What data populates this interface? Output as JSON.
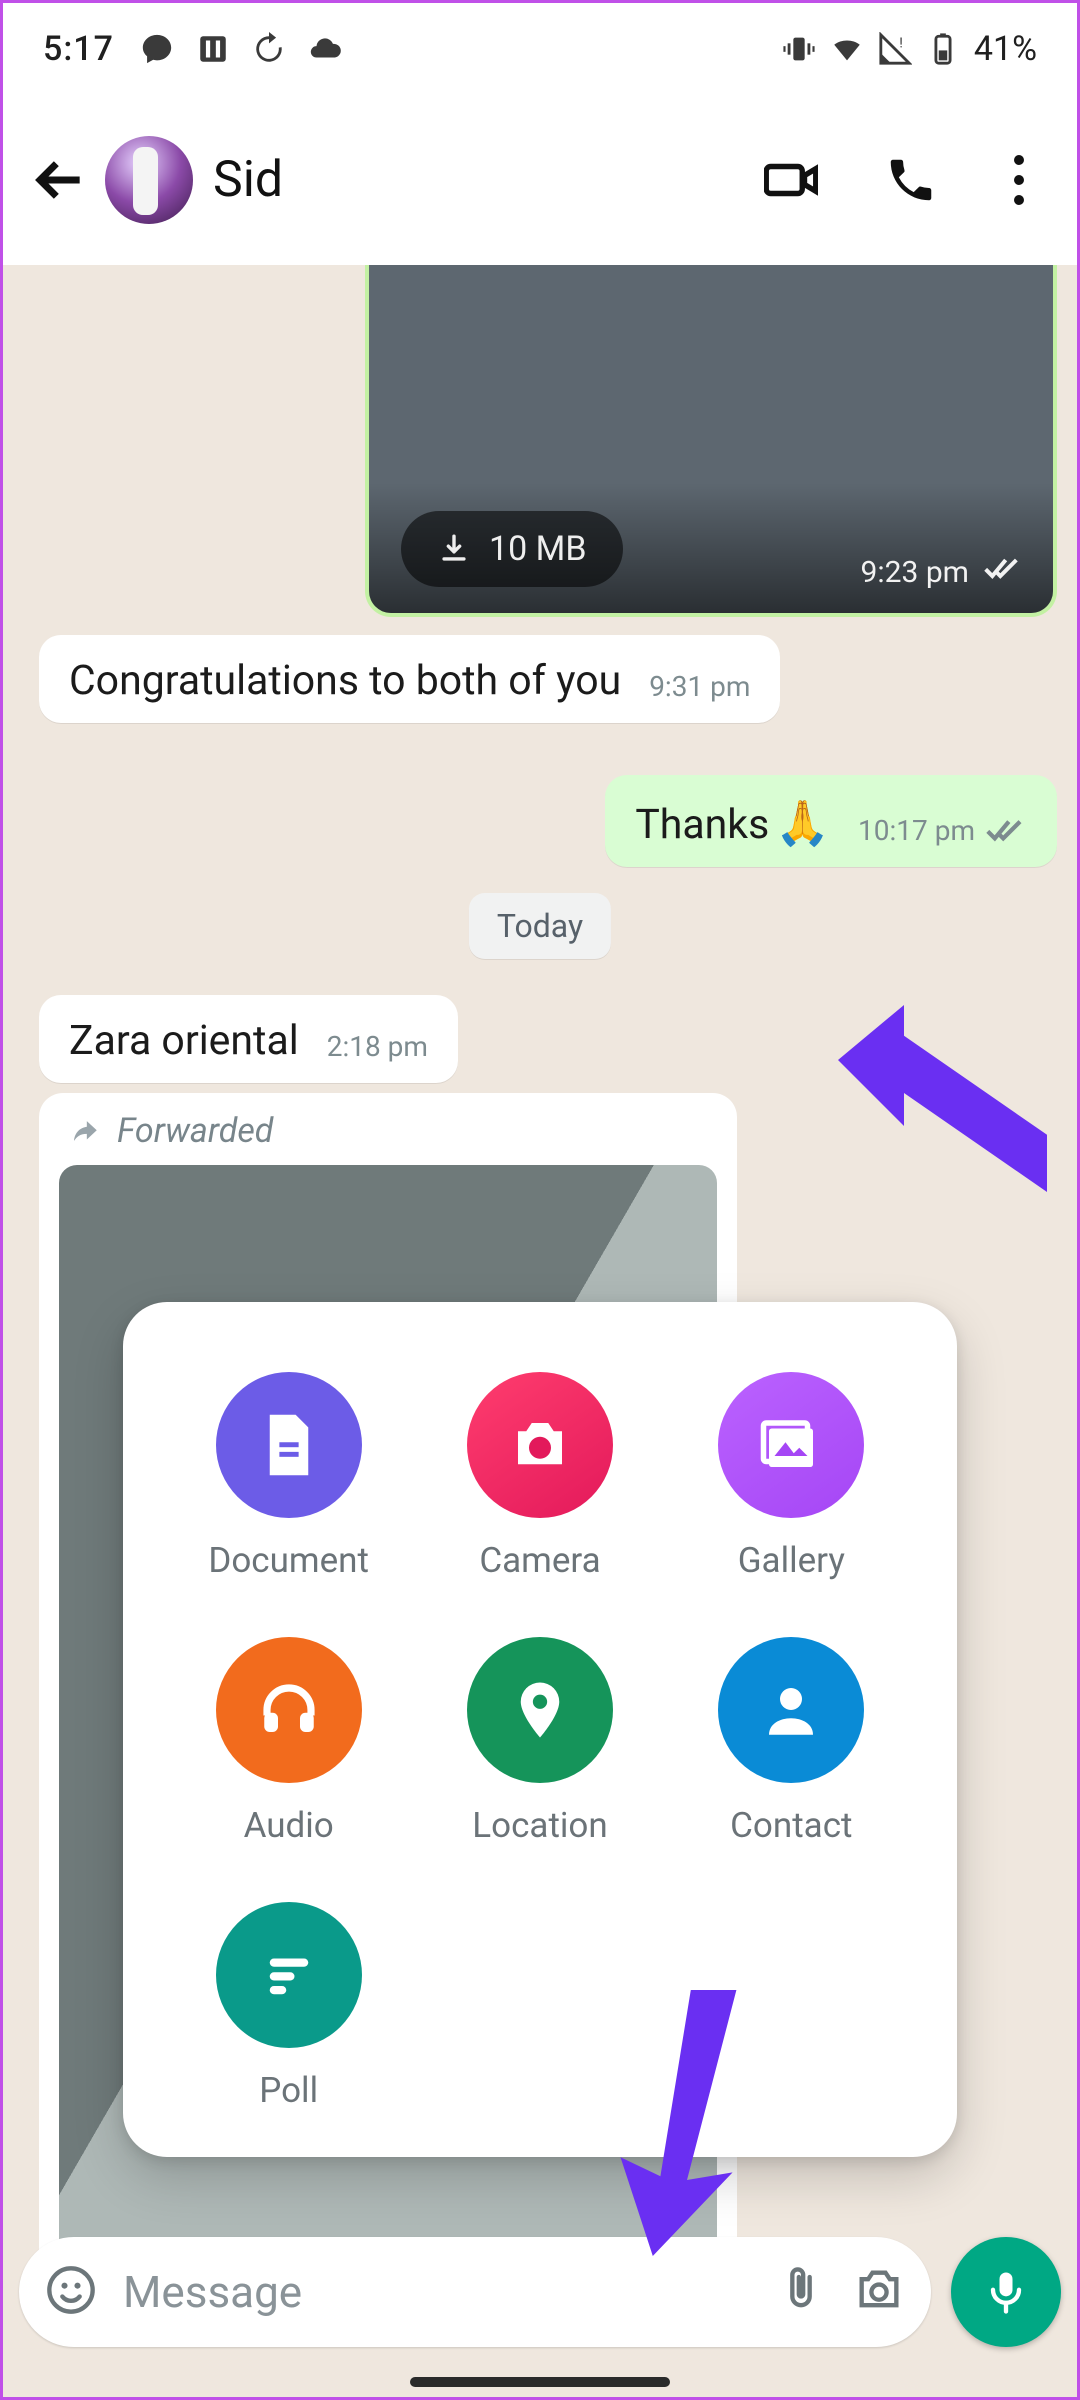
{
  "status": {
    "time": "5:17",
    "battery_text": "41%"
  },
  "header": {
    "contact_name": "Sid"
  },
  "media": {
    "size": "10 MB",
    "time": "9:23 pm"
  },
  "messages": {
    "m1": {
      "text": "Congratulations to both of you",
      "time": "9:31 pm"
    },
    "m2": {
      "text": "Thanks",
      "time": "10:17 pm"
    },
    "m3": {
      "text": "Zara oriental",
      "time": "2:18 pm"
    },
    "date_divider": "Today",
    "forwarded_label": "Forwarded"
  },
  "attachment_sheet": {
    "document": "Document",
    "camera": "Camera",
    "gallery": "Gallery",
    "audio": "Audio",
    "location": "Location",
    "contact": "Contact",
    "poll": "Poll"
  },
  "composer": {
    "placeholder": "Message"
  }
}
